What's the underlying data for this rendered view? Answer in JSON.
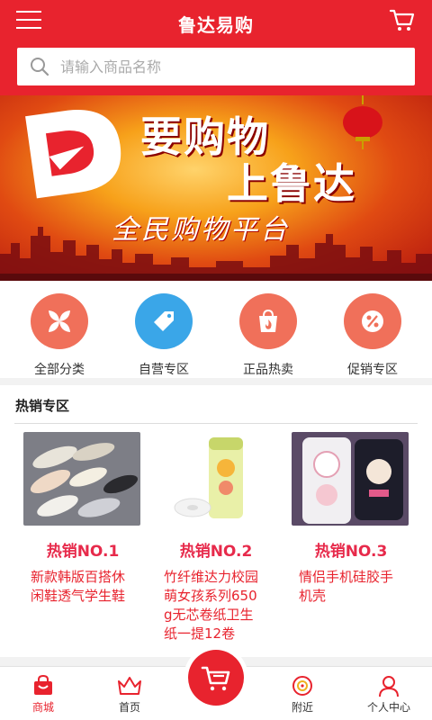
{
  "header": {
    "title": "鲁达易购",
    "menu_icon": "menu-icon",
    "cart_icon": "cart-icon"
  },
  "search": {
    "placeholder": "请输入商品名称",
    "icon": "search-icon"
  },
  "banner": {
    "line1": "要购物",
    "line2": "上鲁达",
    "line3": "全民购物平台"
  },
  "categories": [
    {
      "label": "全部分类",
      "icon": "grid-leaf-icon",
      "color": "#f0705a"
    },
    {
      "label": "自营专区",
      "icon": "tag-icon",
      "color": "#3aa6e8"
    },
    {
      "label": "正品热卖",
      "icon": "hot-bag-icon",
      "color": "#f0705a"
    },
    {
      "label": "促销专区",
      "icon": "percent-icon",
      "color": "#f0705a"
    }
  ],
  "hot_section": {
    "title": "热销专区",
    "products": [
      {
        "rank": "热销NO.1",
        "name": "新款韩版百搭休闲鞋透气学生鞋"
      },
      {
        "rank": "热销NO.2",
        "name": "竹纤维达力校园萌女孩系列650g无芯卷纸卫生纸一提12卷"
      },
      {
        "rank": "热销NO.3",
        "name": "情侣手机硅胶手机壳"
      }
    ]
  },
  "tabbar": {
    "tabs": [
      {
        "label": "商城",
        "icon": "shop-bag-icon",
        "active": true
      },
      {
        "label": "首页",
        "icon": "crown-icon",
        "active": false
      },
      {
        "label": "",
        "icon": "cart-icon",
        "active": false
      },
      {
        "label": "附近",
        "icon": "location-icon",
        "active": false
      },
      {
        "label": "个人中心",
        "icon": "user-icon",
        "active": false
      }
    ]
  },
  "colors": {
    "brand_red": "#e8232e",
    "rank_pink": "#e72a4b"
  }
}
